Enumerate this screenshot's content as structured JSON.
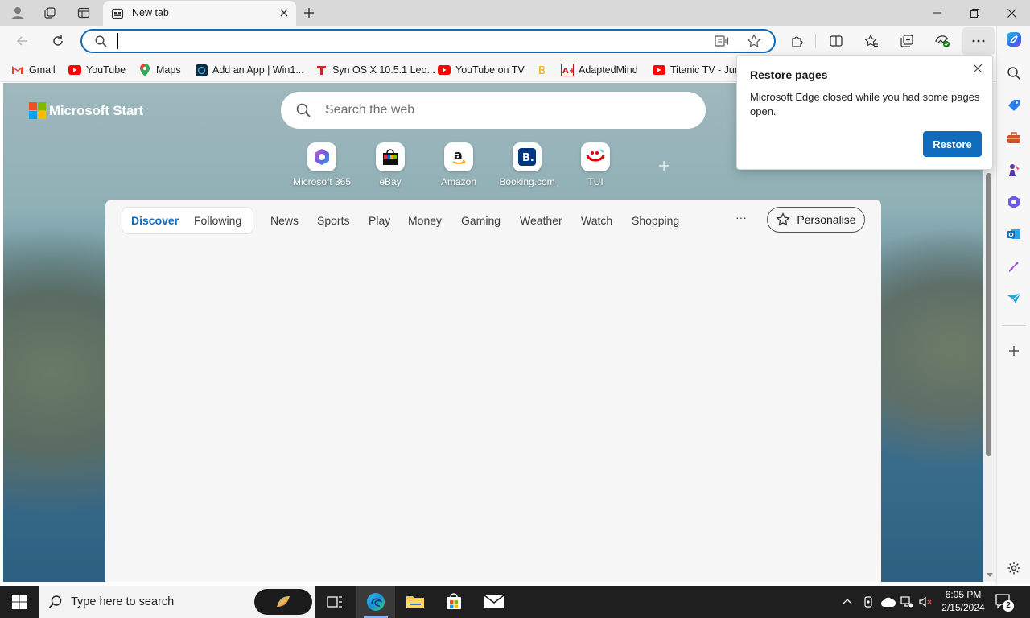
{
  "browser": {
    "tab": {
      "title": "New tab"
    },
    "address": {
      "value": "",
      "placeholder": ""
    }
  },
  "bookmarks": [
    {
      "label": "Gmail",
      "icon": "gmail-icon"
    },
    {
      "label": "YouTube",
      "icon": "youtube-icon"
    },
    {
      "label": "Maps",
      "icon": "maps-icon"
    },
    {
      "label": "Add an App | Win1...",
      "icon": "app-icon"
    },
    {
      "label": "Syn OS X 10.5.1 Leo...",
      "icon": "synos-icon"
    },
    {
      "label": "YouTube on TV",
      "icon": "youtube-icon"
    },
    {
      "label": "",
      "icon": "bitcoin-icon"
    },
    {
      "label": "AdaptedMind",
      "icon": "adaptedmind-icon"
    },
    {
      "label": "Titanic TV - Jun",
      "icon": "youtube-icon"
    }
  ],
  "newtab": {
    "brand": "Microsoft Start",
    "search_placeholder": "Search the web",
    "quick_links": [
      {
        "label": "Microsoft 365"
      },
      {
        "label": "eBay"
      },
      {
        "label": "Amazon"
      },
      {
        "label": "Booking.com"
      },
      {
        "label": "TUI"
      }
    ],
    "feed_nav": {
      "pill": [
        "Discover",
        "Following"
      ],
      "items": [
        "News",
        "Sports",
        "Play",
        "Money",
        "Gaming",
        "Weather",
        "Watch",
        "Shopping"
      ],
      "more": "···",
      "personalise": "Personalise"
    }
  },
  "popup": {
    "title": "Restore pages",
    "message": "Microsoft Edge closed while you had some pages open.",
    "button": "Restore"
  },
  "taskbar": {
    "search_placeholder": "Type here to search",
    "time": "6:05 PM",
    "date": "2/15/2024",
    "notification_count": "2"
  },
  "colors": {
    "accent": "#0f6cbd",
    "taskbar": "#1f1f1f"
  }
}
